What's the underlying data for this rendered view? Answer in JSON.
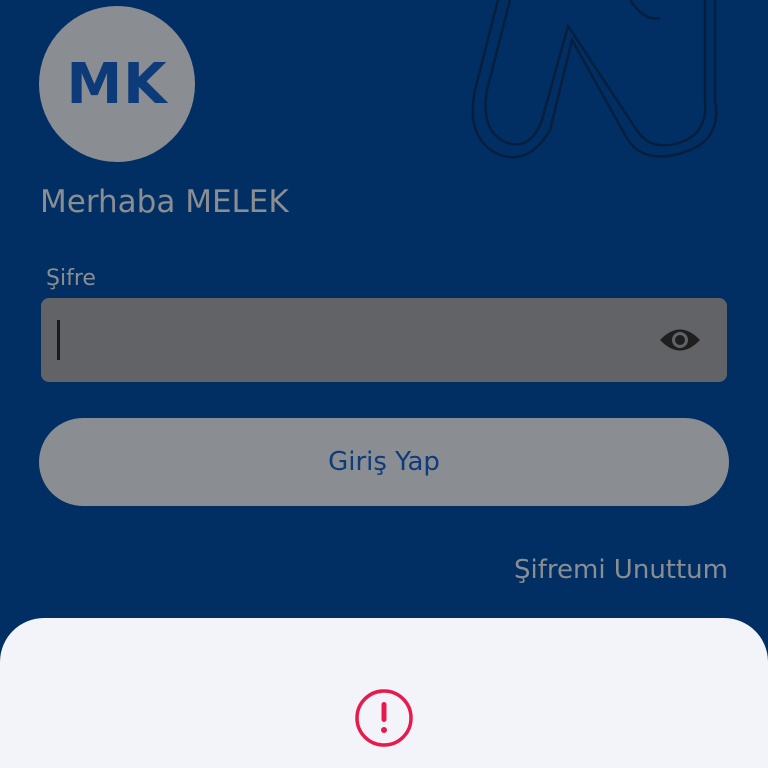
{
  "profile": {
    "initials": "MK",
    "greeting": "Merhaba MELEK"
  },
  "login_form": {
    "password_label": "Şifre",
    "password_value": "",
    "show_password_icon": "eye-icon",
    "submit_label": "Giriş Yap",
    "forgot_password_label": "Şifremi Unuttum"
  },
  "alert_sheet": {
    "icon": "exclamation-circle-icon"
  },
  "colors": {
    "background": "#012f63",
    "overlay_gray": "#8a8d92",
    "input_fill": "#626367",
    "brand_text": "#0e3c7a",
    "sheet_background": "#f2f4f9",
    "alert_red": "#e8194b"
  }
}
